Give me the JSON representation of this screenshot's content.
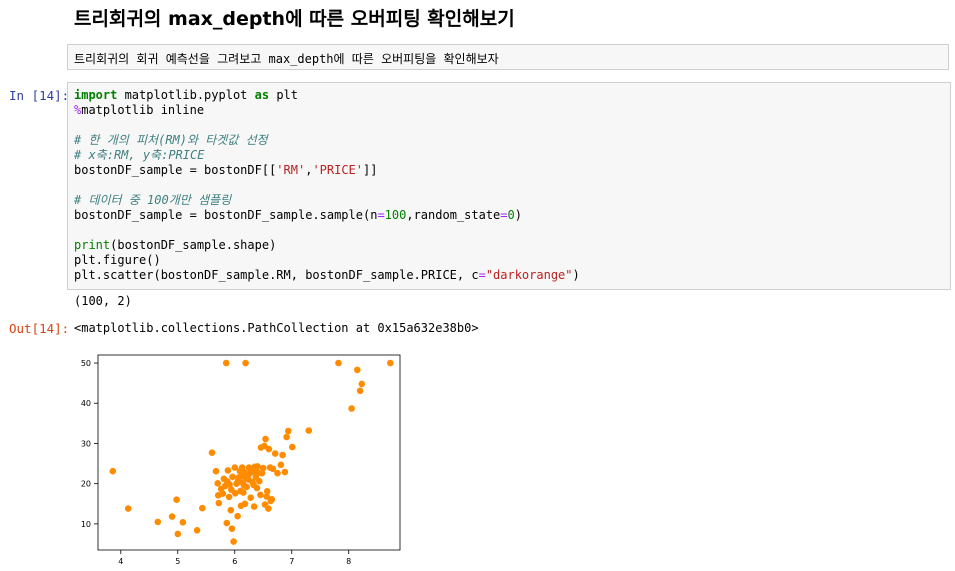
{
  "heading": "트리회귀의 max_depth에 따른 오버피팅 확인해보기",
  "markdown": "트리회귀의 회귀 예측선을 그려보고 max_depth에 따른 오버피팅을 확인해보자",
  "input_prompt": "In [14]:",
  "output_prompt": "Out[14]:",
  "code": {
    "import_kw": "import",
    "import_module": " matplotlib.pyplot ",
    "as_kw": "as",
    "import_alias": " plt",
    "magic_pct": "%",
    "magic_rest": "matplotlib inline",
    "comment1": "# 한 개의 피처(RM)와 타겟값 선정",
    "comment2": "# x축:RM, y축:PRICE",
    "sample_pre": "bostonDF_sample = bostonDF[[",
    "str_rm": "'RM'",
    "comma": ",",
    "str_price": "'PRICE'",
    "sample_post": "]]",
    "comment3": "# 데이터 중 100개만 샘플링",
    "resample_pre": "bostonDF_sample = bostonDF_sample.sample(n",
    "eq1": "=",
    "num100": "100",
    "resample_mid": ",random_state",
    "eq2": "=",
    "num0": "0",
    "resample_post": ")",
    "print_fn": "print",
    "print_rest": "(bostonDF_sample.shape)",
    "figure_line": "plt.figure()",
    "scatter_pre": "plt.scatter(bostonDF_sample.RM, bostonDF_sample.PRICE, c",
    "eq3": "=",
    "scatter_str": "\"darkorange\"",
    "scatter_post": ")"
  },
  "stdout": "(100, 2)",
  "result_repr": "<matplotlib.collections.PathCollection at 0x15a632e38b0>",
  "chart_data": {
    "type": "scatter",
    "color": "#ff8c00",
    "xlim": [
      3.6,
      8.9
    ],
    "ylim": [
      3.5,
      52
    ],
    "xticks": [
      4,
      5,
      6,
      7,
      8
    ],
    "yticks": [
      10,
      20,
      30,
      40,
      50
    ],
    "xlabel": "",
    "ylabel": "",
    "points": [
      [
        3.86,
        23.1
      ],
      [
        4.13,
        13.8
      ],
      [
        4.65,
        10.5
      ],
      [
        4.9,
        11.8
      ],
      [
        4.98,
        16.0
      ],
      [
        5.0,
        7.5
      ],
      [
        5.09,
        10.4
      ],
      [
        5.34,
        8.4
      ],
      [
        5.43,
        13.9
      ],
      [
        5.6,
        27.7
      ],
      [
        5.67,
        23.1
      ],
      [
        5.7,
        20.1
      ],
      [
        5.71,
        17.1
      ],
      [
        5.72,
        15.2
      ],
      [
        5.76,
        18.7
      ],
      [
        5.79,
        17.5
      ],
      [
        5.81,
        21.2
      ],
      [
        5.83,
        19.4
      ],
      [
        5.85,
        50.0
      ],
      [
        5.86,
        10.2
      ],
      [
        5.87,
        20.5
      ],
      [
        5.88,
        23.3
      ],
      [
        5.9,
        16.7
      ],
      [
        5.91,
        19.8
      ],
      [
        5.93,
        13.4
      ],
      [
        5.94,
        18.5
      ],
      [
        5.95,
        8.8
      ],
      [
        5.96,
        21.7
      ],
      [
        5.98,
        5.6
      ],
      [
        6.0,
        24.0
      ],
      [
        6.01,
        17.6
      ],
      [
        6.03,
        20.0
      ],
      [
        6.05,
        11.9
      ],
      [
        6.06,
        20.8
      ],
      [
        6.07,
        21.5
      ],
      [
        6.09,
        23.1
      ],
      [
        6.1,
        18.2
      ],
      [
        6.11,
        14.5
      ],
      [
        6.12,
        21.9
      ],
      [
        6.13,
        24.0
      ],
      [
        6.14,
        20.3
      ],
      [
        6.15,
        17.8
      ],
      [
        6.16,
        19.6
      ],
      [
        6.17,
        22.8
      ],
      [
        6.18,
        15.0
      ],
      [
        6.19,
        50.0
      ],
      [
        6.2,
        21.4
      ],
      [
        6.21,
        19.2
      ],
      [
        6.23,
        22.2
      ],
      [
        6.24,
        21.0
      ],
      [
        6.25,
        24.0
      ],
      [
        6.26,
        22.5
      ],
      [
        6.28,
        16.5
      ],
      [
        6.3,
        23.5
      ],
      [
        6.31,
        20.4
      ],
      [
        6.32,
        22.9
      ],
      [
        6.33,
        19.7
      ],
      [
        6.34,
        14.3
      ],
      [
        6.35,
        24.2
      ],
      [
        6.37,
        21.6
      ],
      [
        6.38,
        23.0
      ],
      [
        6.39,
        18.9
      ],
      [
        6.4,
        24.3
      ],
      [
        6.41,
        22.7
      ],
      [
        6.43,
        20.6
      ],
      [
        6.45,
        17.2
      ],
      [
        6.46,
        29.0
      ],
      [
        6.48,
        22.6
      ],
      [
        6.5,
        23.9
      ],
      [
        6.52,
        29.4
      ],
      [
        6.53,
        14.8
      ],
      [
        6.54,
        31.1
      ],
      [
        6.56,
        16.8
      ],
      [
        6.57,
        18.1
      ],
      [
        6.59,
        13.8
      ],
      [
        6.6,
        28.6
      ],
      [
        6.62,
        24.0
      ],
      [
        6.63,
        15.7
      ],
      [
        6.65,
        16.1
      ],
      [
        6.67,
        23.7
      ],
      [
        6.71,
        27.5
      ],
      [
        6.75,
        22.6
      ],
      [
        6.81,
        24.7
      ],
      [
        6.84,
        27.1
      ],
      [
        6.88,
        22.9
      ],
      [
        6.91,
        31.6
      ],
      [
        6.94,
        33.1
      ],
      [
        7.01,
        29.1
      ],
      [
        7.3,
        33.2
      ],
      [
        7.82,
        50.0
      ],
      [
        8.05,
        38.7
      ],
      [
        8.15,
        48.3
      ],
      [
        8.2,
        43.1
      ],
      [
        8.23,
        44.8
      ],
      [
        8.73,
        50.0
      ]
    ]
  }
}
